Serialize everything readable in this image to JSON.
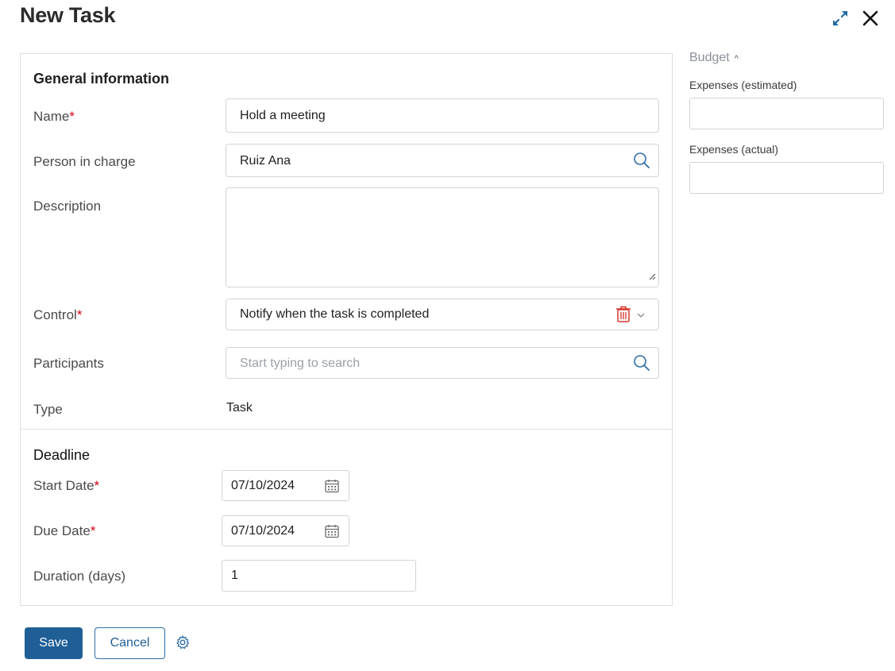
{
  "header": {
    "title": "New Task",
    "expand_icon": "expand-icon",
    "close_icon": "close-icon"
  },
  "general": {
    "section_title": "General information",
    "name": {
      "label": "Name",
      "required": "*",
      "value": "Hold a meeting"
    },
    "person_in_charge": {
      "label": "Person in charge",
      "value": "Ruiz Ana"
    },
    "description": {
      "label": "Description",
      "value": ""
    },
    "control": {
      "label": "Control",
      "required": "*",
      "value": "Notify when the task is completed"
    },
    "participants": {
      "label": "Participants",
      "placeholder": "Start typing to search"
    },
    "type": {
      "label": "Type",
      "value": "Task"
    }
  },
  "deadline": {
    "section_title": "Deadline",
    "start_date": {
      "label": "Start Date",
      "required": "*",
      "value": "07/10/2024"
    },
    "due_date": {
      "label": "Due Date",
      "required": "*",
      "value": "07/10/2024"
    },
    "duration": {
      "label": "Duration (days)",
      "value": "1"
    }
  },
  "budget": {
    "header": "Budget",
    "caret": "^",
    "expenses_estimated": {
      "label": "Expenses (estimated)",
      "value": ""
    },
    "expenses_actual": {
      "label": "Expenses (actual)",
      "value": ""
    }
  },
  "footer": {
    "save_label": "Save",
    "cancel_label": "Cancel"
  },
  "colors": {
    "primary": "#1f5f96",
    "required": "#d0021b",
    "delete": "#d9342b"
  }
}
